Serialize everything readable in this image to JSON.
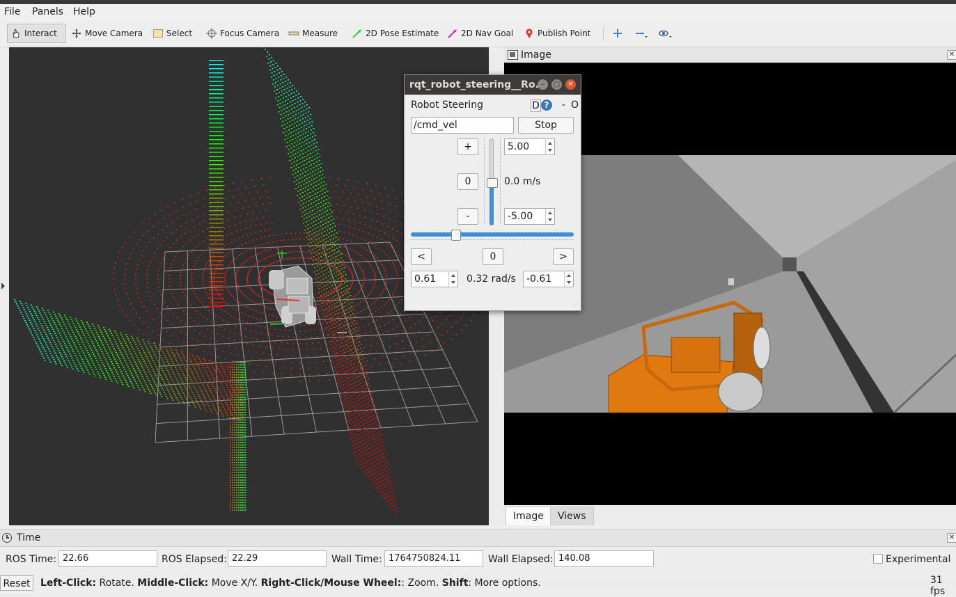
{
  "menu": {
    "file": "File",
    "panels": "Panels",
    "help": "Help"
  },
  "toolbar": {
    "interact": "Interact",
    "move_camera": "Move Camera",
    "select": "Select",
    "focus_camera": "Focus Camera",
    "measure": "Measure",
    "pose_estimate": "2D Pose Estimate",
    "nav_goal": "2D Nav Goal",
    "publish_point": "Publish Point"
  },
  "image_panel": {
    "title": "Image",
    "tabs": [
      "Image",
      "Views"
    ]
  },
  "steering": {
    "window_title": "rqt_robot_steering__Ro...",
    "plugin_label": "Robot Steering",
    "d_label": "D",
    "help_label": "?",
    "dash_label": "-",
    "o_label": "O",
    "topic": "/cmd_vel",
    "stop_label": "Stop",
    "plus_label": "+",
    "zero_linear_label": "0",
    "minus_label": "-",
    "linear_max": "5.00",
    "linear_min": "-5.00",
    "linear_value": "0.0 m/s",
    "linear_level": 0.5,
    "left_label": "<",
    "zero_angular_label": "0",
    "right_label": ">",
    "angular_max": "0.61",
    "angular_value": "0.32 rad/s",
    "angular_min": "-0.61",
    "angular_level": 0.26
  },
  "time_panel": {
    "title": "Time",
    "ros_time_label": "ROS Time:",
    "ros_time": "22.66",
    "ros_elapsed_label": "ROS Elapsed:",
    "ros_elapsed": "22.29",
    "wall_time_label": "Wall Time:",
    "wall_time": "1764750824.11",
    "wall_elapsed_label": "Wall Elapsed:",
    "wall_elapsed": "140.08",
    "experimental_label": "Experimental"
  },
  "status": {
    "reset_label": "Reset",
    "hint_parts": [
      "Left-Click:",
      " Rotate. ",
      "Middle-Click:",
      " Move X/Y. ",
      "Right-Click/Mouse Wheel:",
      ": Zoom. ",
      "Shift",
      ": More options."
    ],
    "fps": "31 fps"
  },
  "colors": {
    "accent": "#3d8fd6",
    "scan_near": "#e02020",
    "robot_orange": "#e07a10",
    "titlebar": "#3c3b37"
  }
}
